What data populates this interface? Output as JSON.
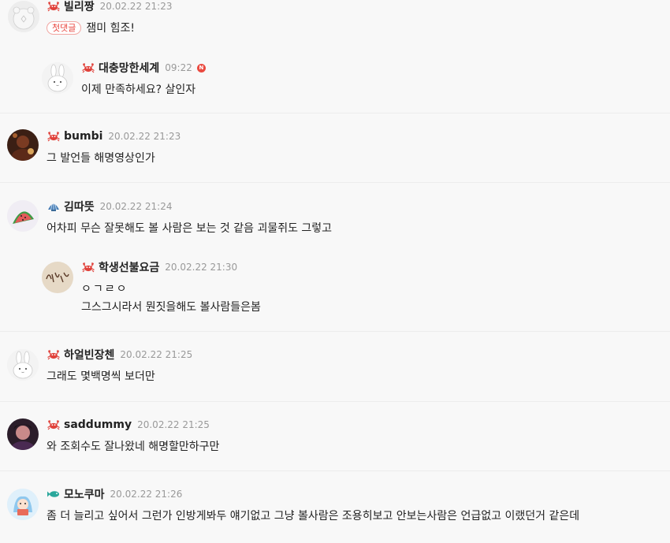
{
  "comments": [
    {
      "nick": "빌리짱",
      "date": "20.02.22 21:23",
      "first_tag": "첫댓글",
      "text": "잼미 힘조!",
      "badge": "crab-icon",
      "avatar": "gray-bear"
    },
    {
      "nick": "대충망한세계",
      "date": "09:22",
      "new_mark": "N",
      "text": "이제 만족하세요? 살인자",
      "badge": "crab-icon",
      "avatar": "white-rabbit"
    },
    {
      "nick": "bumbi",
      "date": "20.02.22 21:23",
      "text": "그 발언들 해명영상인가",
      "badge": "crab-icon",
      "avatar": "dark-photo"
    },
    {
      "nick": "김따뜻",
      "date": "20.02.22 21:24",
      "text": "어차피 무슨 잘못해도 볼 사람은 보는 것 같음 괴물쥐도 그렇고",
      "badge": "shell-icon",
      "avatar": "watermelon"
    },
    {
      "nick": "학생선불요금",
      "date": "20.02.22 21:30",
      "text_lines": [
        "ㅇㄱㄹㅇ",
        "그스그시라서 뭔짓을해도 볼사람들은봄"
      ],
      "badge": "crab-icon",
      "avatar": "calligraphy"
    },
    {
      "nick": "하얼빈장첸",
      "date": "20.02.22 21:25",
      "text": "그래도 몇백명씩 보더만",
      "badge": "crab-icon",
      "avatar": "white-rabbit"
    },
    {
      "nick": "saddummy",
      "date": "20.02.22 21:25",
      "text": "와 조회수도 잘나왔네 해명할만하구만",
      "badge": "crab-icon",
      "avatar": "dark-person"
    },
    {
      "nick": "모노쿠마",
      "date": "20.02.22 21:26",
      "text": "좀 더 늘리고 싶어서 그런가 인방게봐두 얘기없고 그냥 볼사람은 조용히보고 안보는사람은 언급없고 이랬던거 같은데",
      "badge": "fish-icon",
      "avatar": "cartoon"
    }
  ],
  "colors": {
    "background": "#f8f8f8",
    "nick": "#222222",
    "date": "#999999",
    "first_tag": "#e8463f",
    "new_badge": "#ea4a40",
    "crab": "#e0413a",
    "shell": "#4a7fb5",
    "fish": "#2aa79b"
  }
}
